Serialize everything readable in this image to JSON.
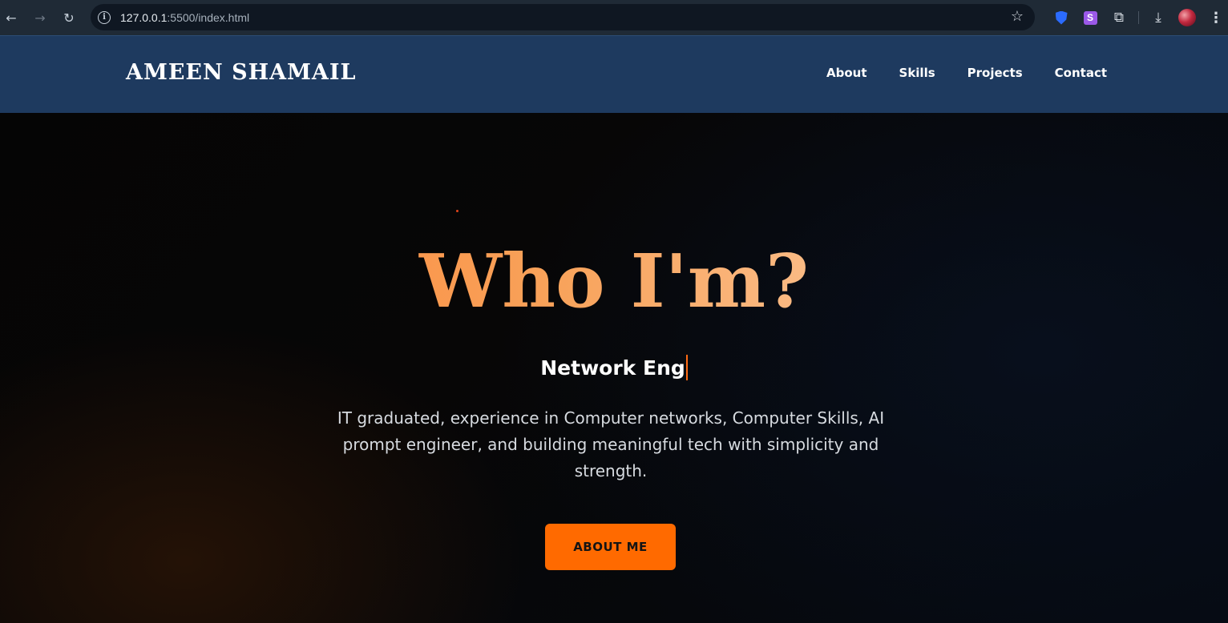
{
  "browser": {
    "url_host": "127.0.0.1",
    "url_rest": ":5500/index.html",
    "back_glyph": "←",
    "forward_glyph": "→",
    "reload_glyph": "↻",
    "star_glyph": "☆",
    "download_glyph": "⤓",
    "menu_glyph": "⋮",
    "s_extension_letter": "S",
    "puzzle_glyph": "⧉"
  },
  "header": {
    "brand": "AMEEN SHAMAIL",
    "nav": [
      {
        "label": "About"
      },
      {
        "label": "Skills"
      },
      {
        "label": "Projects"
      },
      {
        "label": "Contact"
      }
    ],
    "background_color": "#1e3a5f"
  },
  "hero": {
    "title": "Who I'm?",
    "typed_text": "Network Eng",
    "description": "IT graduated, experience in Computer networks, Computer Skills, AI prompt engineer, and building meaningful tech with simplicity and strength.",
    "cta_label": "ABOUT ME",
    "accent_color": "#ff6a00"
  }
}
